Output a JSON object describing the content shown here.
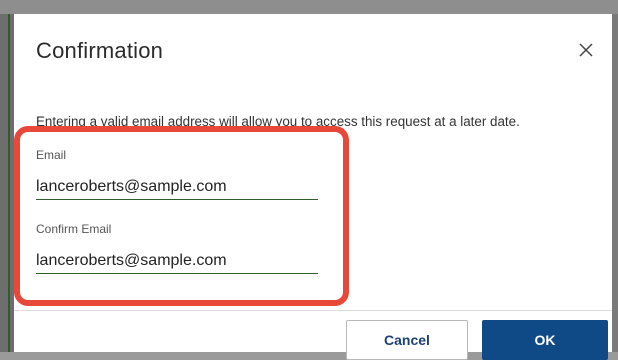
{
  "dialog": {
    "title": "Confirmation",
    "message": "Entering a valid email address will allow you to access this request at a later date.",
    "close_icon": "close-icon"
  },
  "form": {
    "email_label": "Email",
    "email_value": "lanceroberts@sample.com",
    "confirm_email_label": "Confirm Email",
    "confirm_email_value": "lanceroberts@sample.com"
  },
  "footer": {
    "cancel_label": "Cancel",
    "ok_label": "OK"
  },
  "colors": {
    "highlight": "#e8483a",
    "primary_button": "#0f4a86",
    "input_underline": "#2e5f2a"
  }
}
